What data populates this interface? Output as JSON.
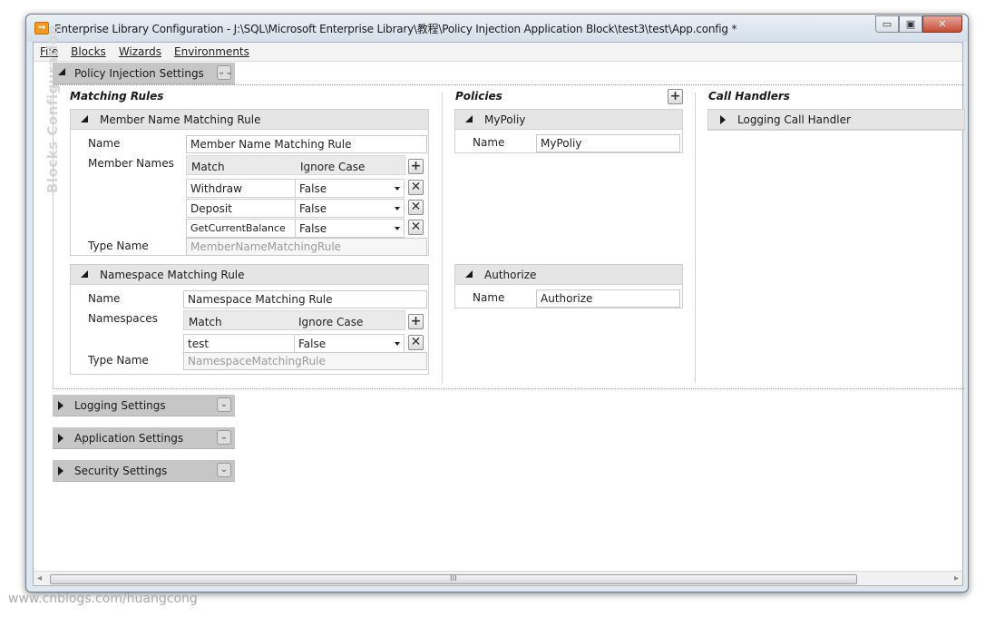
{
  "window": {
    "icon": "app-icon",
    "title": "Enterprise Library Configuration - J:\\SQL\\Microsoft Enterprise Library\\教程\\Policy Injection Application Block\\test3\\test\\App.config *",
    "minimize": "▭",
    "maximize": "▣",
    "close": "✕"
  },
  "menu": [
    "File",
    "Blocks",
    "Wizards",
    "Environments"
  ],
  "side_label": "Blocks Configuration",
  "policy_section": {
    "label": "Policy Injection Settings",
    "chevron": "⌄⌄"
  },
  "matching_rules": {
    "title": "Matching Rules",
    "rules": [
      {
        "header": "Member Name Matching Rule",
        "name_label": "Name",
        "name_value": "Member Name Matching Rule",
        "list_label": "Member Names",
        "col_match": "Match",
        "col_ignore": "Ignore Case",
        "rows": [
          {
            "match": "Withdraw",
            "ignore": "False"
          },
          {
            "match": "Deposit",
            "ignore": "False"
          },
          {
            "match": "GetCurrentBalance",
            "ignore": "False"
          }
        ],
        "type_label": "Type Name",
        "type_value": "MemberNameMatchingRule"
      },
      {
        "header": "Namespace Matching Rule",
        "name_label": "Name",
        "name_value": "Namespace Matching Rule",
        "list_label": "Namespaces",
        "col_match": "Match",
        "col_ignore": "Ignore Case",
        "rows": [
          {
            "match": "test",
            "ignore": "False"
          }
        ],
        "type_label": "Type Name",
        "type_value": "NamespaceMatchingRule"
      }
    ]
  },
  "policies": {
    "title": "Policies",
    "items": [
      {
        "header": "MyPoliy",
        "name_label": "Name",
        "name_value": "MyPoliy"
      },
      {
        "header": "Authorize",
        "name_label": "Name",
        "name_value": "Authorize"
      }
    ]
  },
  "call_handlers": {
    "title": "Call Handlers",
    "items": [
      {
        "header": "Logging Call Handler"
      }
    ]
  },
  "collapsed_sections": [
    {
      "label": "Logging Settings"
    },
    {
      "label": "Application Settings"
    },
    {
      "label": "Security Settings"
    }
  ],
  "scrollbar": {
    "grip": "III"
  },
  "watermark": "www.cnblogs.com/huangcong"
}
